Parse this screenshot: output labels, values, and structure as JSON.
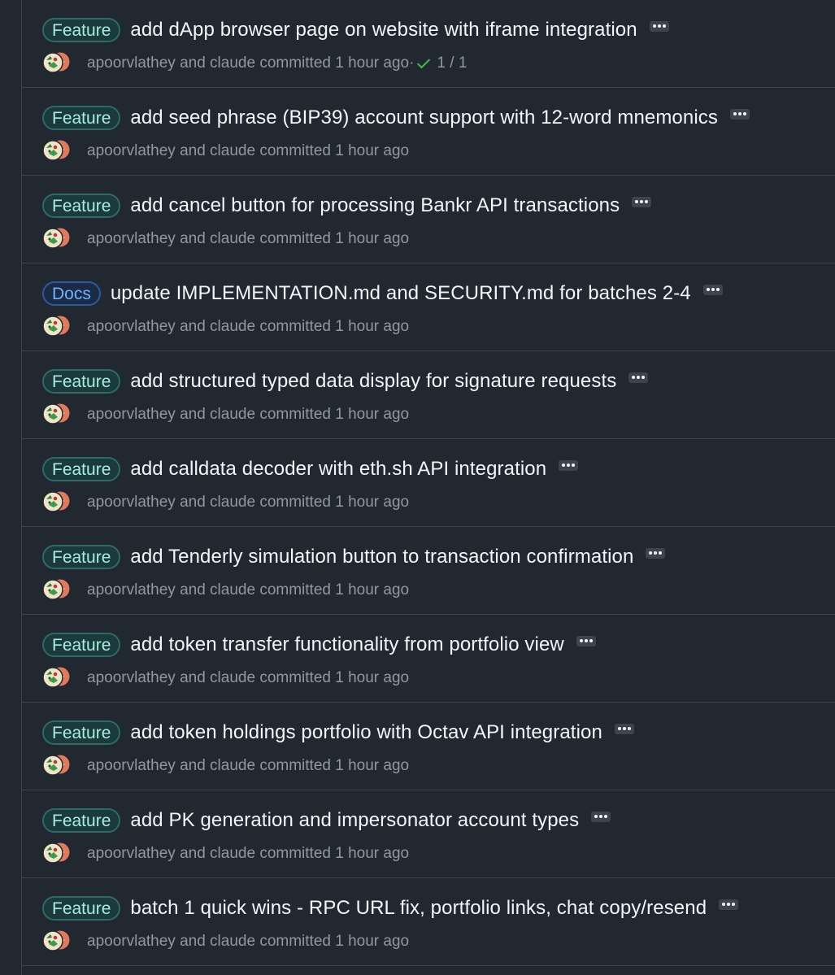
{
  "commits": [
    {
      "badge": "Feature",
      "badge_type": "feature",
      "title": "add dApp browser page on website with iframe integration",
      "meta": "apoorvlathey and claude committed 1 hour ago",
      "checks": "1 / 1",
      "separator": "·"
    },
    {
      "badge": "Feature",
      "badge_type": "feature",
      "title": "add seed phrase (BIP39) account support with 12-word mnemonics",
      "meta": "apoorvlathey and claude committed 1 hour ago"
    },
    {
      "badge": "Feature",
      "badge_type": "feature",
      "title": "add cancel button for processing Bankr API transactions",
      "meta": "apoorvlathey and claude committed 1 hour ago"
    },
    {
      "badge": "Docs",
      "badge_type": "docs",
      "title": "update IMPLEMENTATION.md and SECURITY.md for batches 2-4",
      "meta": "apoorvlathey and claude committed 1 hour ago"
    },
    {
      "badge": "Feature",
      "badge_type": "feature",
      "title": "add structured typed data display for signature requests",
      "meta": "apoorvlathey and claude committed 1 hour ago"
    },
    {
      "badge": "Feature",
      "badge_type": "feature",
      "title": "add calldata decoder with eth.sh API integration",
      "meta": "apoorvlathey and claude committed 1 hour ago"
    },
    {
      "badge": "Feature",
      "badge_type": "feature",
      "title": "add Tenderly simulation button to transaction confirmation",
      "meta": "apoorvlathey and claude committed 1 hour ago"
    },
    {
      "badge": "Feature",
      "badge_type": "feature",
      "title": "add token transfer functionality from portfolio view",
      "meta": "apoorvlathey and claude committed 1 hour ago"
    },
    {
      "badge": "Feature",
      "badge_type": "feature",
      "title": "add token holdings portfolio with Octav API integration",
      "meta": "apoorvlathey and claude committed 1 hour ago"
    },
    {
      "badge": "Feature",
      "badge_type": "feature",
      "title": "add PK generation and impersonator account types",
      "meta": "apoorvlathey and claude committed 1 hour ago"
    },
    {
      "badge": "Feature",
      "badge_type": "feature",
      "title": "batch 1 quick wins - RPC URL fix, portfolio links, chat copy/resend",
      "meta": "apoorvlathey and claude committed 1 hour ago"
    }
  ],
  "icons": {
    "ellipsis": "kebab-horizontal-icon",
    "check": "check-icon",
    "avatar": "avatar-icon"
  },
  "colors": {
    "background": "#212830",
    "border": "#3d444d",
    "title": "#f0f6fc",
    "meta": "#9198a1",
    "check": "#3fb950"
  }
}
